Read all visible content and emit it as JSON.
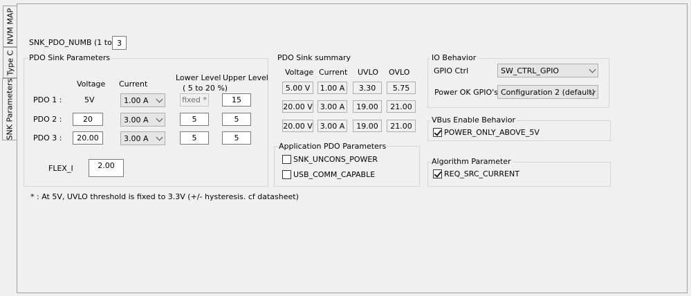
{
  "tabs": [
    {
      "label": "NVM MAP",
      "active": false
    },
    {
      "label": "Type C",
      "active": false
    },
    {
      "label": "SNK Parameters",
      "active": true
    }
  ],
  "pdo_numb": {
    "label": "SNK_PDO_NUMB (1 to 3)",
    "value": "3"
  },
  "sink_params": {
    "title": "PDO Sink Parameters",
    "col_voltage": "Voltage",
    "col_current": "Current",
    "col_lower": "Lower Level",
    "col_lower_range": "( 5 to 20 %)",
    "col_upper": "Upper Level",
    "rows": [
      {
        "label": "PDO 1 :",
        "voltage": "5V",
        "current": "1.00 A",
        "lower": "fixed *",
        "upper": "15"
      },
      {
        "label": "PDO 2 :",
        "voltage": "20",
        "current": "3.00 A",
        "lower": "5",
        "upper": "5"
      },
      {
        "label": "PDO 3 :",
        "voltage": "20.00",
        "current": "3.00 A",
        "lower": "5",
        "upper": "5"
      }
    ],
    "flex_label": "FLEX_I",
    "flex_value": "2.00"
  },
  "footnote": "* : At 5V, UVLO threshold is fixed to 3.3V (+/- hysteresis. cf datasheet)",
  "summary": {
    "title": "PDO Sink summary",
    "headers": [
      "Voltage",
      "Current",
      "UVLO",
      "OVLO"
    ],
    "rows": [
      [
        "5.00 V",
        "1.00 A",
        "3.30",
        "5.75"
      ],
      [
        "20.00 V",
        "3.00 A",
        "19.00",
        "21.00"
      ],
      [
        "20.00 V",
        "3.00 A",
        "19.00",
        "21.00"
      ]
    ]
  },
  "app_pdo": {
    "title": "Application PDO Parameters",
    "options": [
      {
        "label": "SNK_UNCONS_POWER",
        "checked": false
      },
      {
        "label": "USB_COMM_CAPABLE",
        "checked": false
      }
    ]
  },
  "io": {
    "title": "IO Behavior",
    "gpio_label": "GPIO Ctrl",
    "gpio_value": "SW_CTRL_GPIO",
    "powerok_label": "Power OK GPIO's",
    "powerok_value": "Configuration 2 (default)"
  },
  "vbus": {
    "title": "VBus Enable Behavior",
    "option": {
      "label": "POWER_ONLY_ABOVE_5V",
      "checked": true
    }
  },
  "algo": {
    "title": "Algorithm Parameter",
    "option": {
      "label": "REQ_SRC_CURRENT",
      "checked": true
    }
  }
}
